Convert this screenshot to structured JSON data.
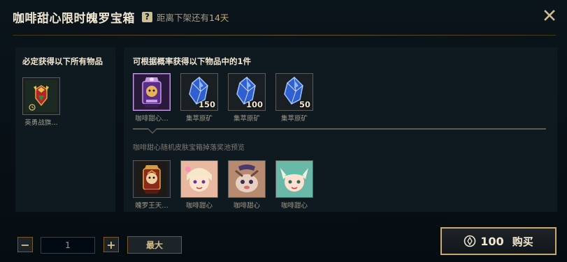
{
  "header": {
    "title": "咖啡甜心限时魄罗宝箱",
    "help_icon": "?",
    "countdown_prefix": "距离下架还有",
    "countdown_days": "14天"
  },
  "guaranteed": {
    "title": "必定获得以下所有物品",
    "items": [
      {
        "label": "英勇战旗…",
        "icon": "banner-icon"
      }
    ]
  },
  "chance": {
    "title": "可根据概率获得以下物品中的1件",
    "items": [
      {
        "label": "咖啡甜心…",
        "icon": "poro-chest-icon",
        "qty": "",
        "selected": true
      },
      {
        "label": "集萃原矿",
        "icon": "crystal-icon",
        "qty": "150"
      },
      {
        "label": "集萃原矿",
        "icon": "crystal-icon",
        "qty": "100"
      },
      {
        "label": "集萃原矿",
        "icon": "crystal-icon",
        "qty": "50"
      }
    ],
    "pool_caption": "咖啡甜心随机皮肤宝箱掉落奖池预览",
    "pool_items": [
      {
        "label": "魄罗王天…",
        "icon": "poro-banner-icon"
      },
      {
        "label": "咖啡甜心",
        "icon": "champion-portrait-icon"
      },
      {
        "label": "咖啡甜心",
        "icon": "champion-portrait-icon"
      },
      {
        "label": "咖啡甜心",
        "icon": "champion-portrait-icon"
      }
    ]
  },
  "controls": {
    "minus": "−",
    "plus": "+",
    "quantity": "1",
    "max_label": "最大",
    "price": "100",
    "buy_label": "购买"
  },
  "colors": {
    "gold": "#c8aa6e",
    "text_light": "#f0e6d2",
    "text_muted": "#a09b8c",
    "panel_bg": "#0f1a20"
  }
}
